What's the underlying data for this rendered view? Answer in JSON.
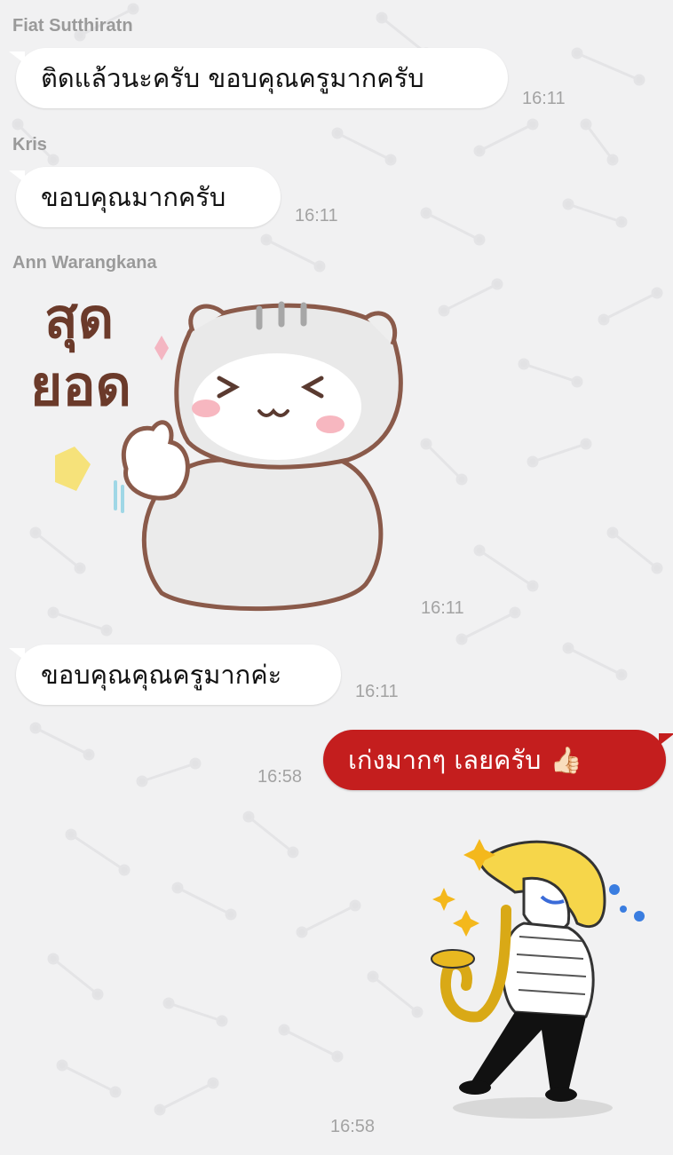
{
  "chat": {
    "messages": [
      {
        "sender": "Fiat Sutthiratn",
        "text": "ติดแล้วนะครับ ขอบคุณครูมากครับ",
        "time": "16:11"
      },
      {
        "sender": "Kris",
        "text": "ขอบคุณมากครับ",
        "time": "16:11"
      },
      {
        "sender": "Ann Warangkana",
        "sticker_text_line1": "สุด",
        "sticker_text_line2": "ยอด",
        "time": "16:11"
      },
      {
        "text": "ขอบคุณคุณครูมากค่ะ",
        "time": "16:11"
      },
      {
        "text": "เก่งมากๆ เลยครับ",
        "emoji": "👍🏻",
        "time": "16:58"
      },
      {
        "sticker": "saxophone-player-sticker",
        "time": "16:58"
      }
    ]
  },
  "colors": {
    "background": "#f1f1f2",
    "incoming_bubble": "#ffffff",
    "outgoing_bubble": "#c41e1e",
    "timestamp": "#a3a3a3",
    "sender_name": "#9a9a9a"
  }
}
